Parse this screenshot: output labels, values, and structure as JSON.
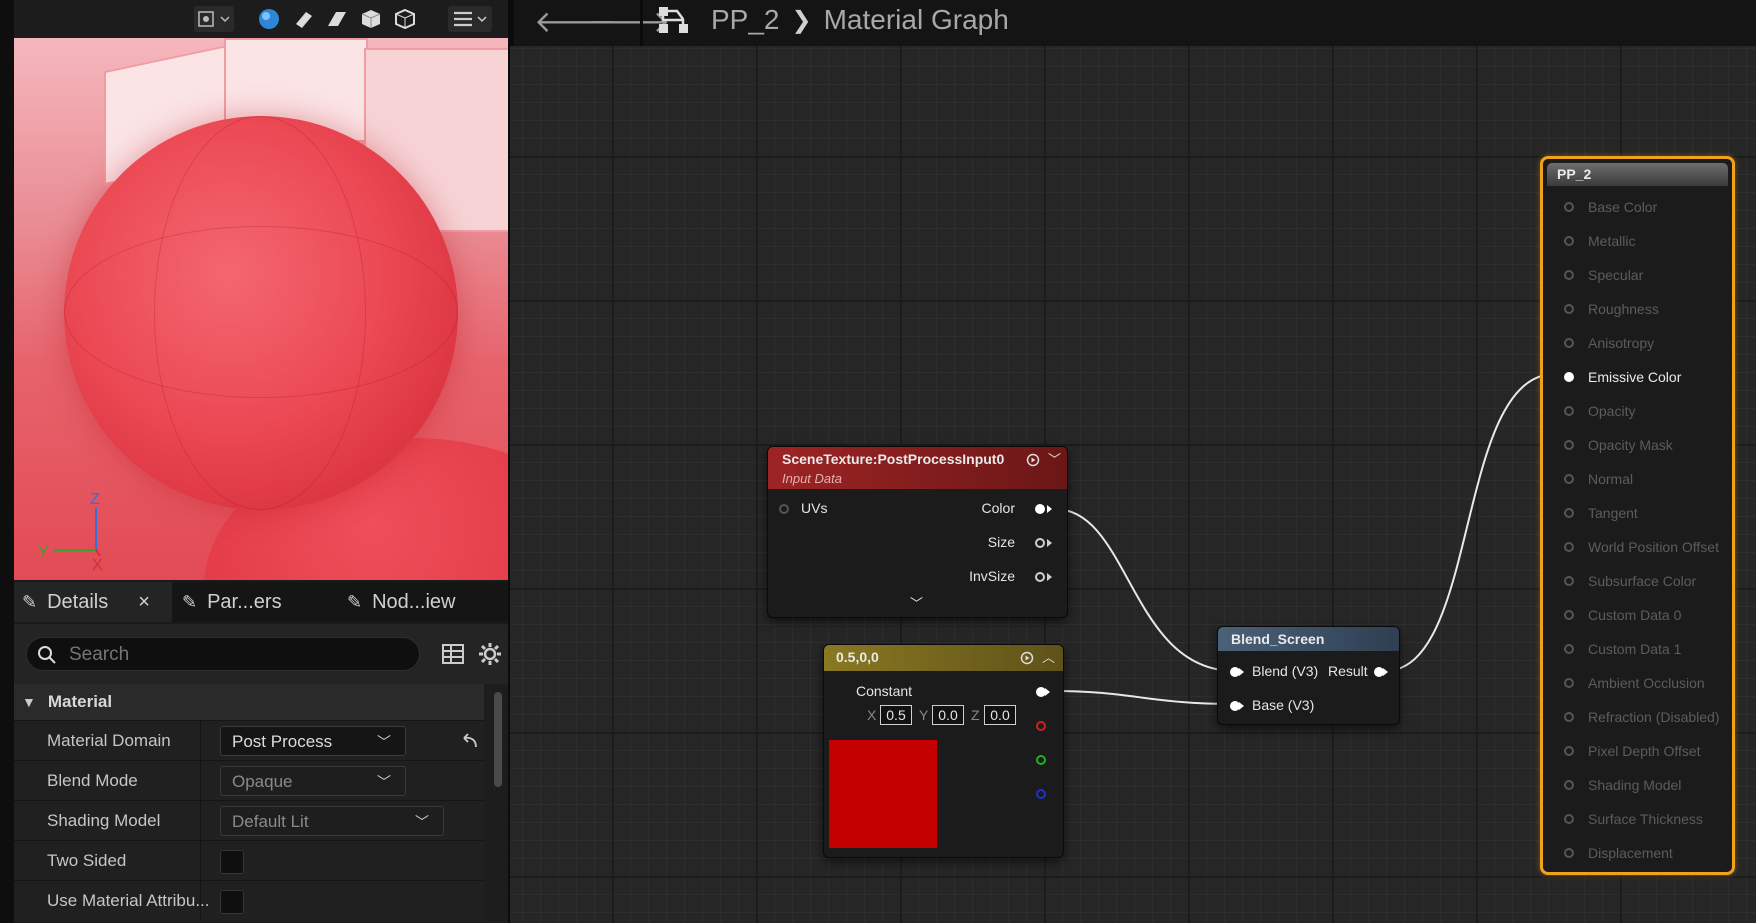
{
  "viewport": {
    "axes": {
      "z": "Z",
      "y": "Y",
      "x": "X"
    }
  },
  "tabs": [
    {
      "label": "Details",
      "close": "×"
    },
    {
      "label": "Par...ers"
    },
    {
      "label": "Nod...iew"
    }
  ],
  "search": {
    "placeholder": "Search"
  },
  "details": {
    "category": "Material",
    "rows": [
      {
        "label": "Material Domain",
        "value": "Post Process"
      },
      {
        "label": "Blend Mode",
        "value": "Opaque"
      },
      {
        "label": "Shading Model",
        "value": "Default Lit"
      },
      {
        "label": "Two Sided"
      },
      {
        "label": "Use Material Attribu..."
      }
    ]
  },
  "breadcrumb": {
    "asset": "PP_2",
    "graph": "Material Graph"
  },
  "nodes": {
    "scene_texture": {
      "title": "SceneTexture:PostProcessInput0",
      "subtitle": "Input Data",
      "inputs": [
        "UVs"
      ],
      "outputs": [
        "Color",
        "Size",
        "InvSize"
      ]
    },
    "constant": {
      "title": "0.5,0,0",
      "label": "Constant",
      "x": "0.5",
      "y": "0.0",
      "z": "0.0",
      "axis_x": "X",
      "axis_y": "Y",
      "axis_z": "Z",
      "color": "#c40000"
    },
    "blend_screen": {
      "title": "Blend_Screen",
      "inputs": [
        "Blend (V3)",
        "Base (V3)"
      ],
      "output": "Result"
    },
    "pp2": {
      "title": "PP_2",
      "inputs": [
        "Base Color",
        "Metallic",
        "Specular",
        "Roughness",
        "Anisotropy",
        "Emissive Color",
        "Opacity",
        "Opacity Mask",
        "Normal",
        "Tangent",
        "World Position Offset",
        "Subsurface Color",
        "Custom Data 0",
        "Custom Data 1",
        "Ambient Occlusion",
        "Refraction (Disabled)",
        "Pixel Depth Offset",
        "Shading Model",
        "Surface Thickness",
        "Displacement"
      ],
      "active_input": "Emissive Color"
    }
  },
  "colors": {
    "scene_header": "#8c1e1e",
    "constant_header": "#7a6a1e",
    "blend_header": "#3b4f63",
    "output_border": "#f0a21c"
  }
}
